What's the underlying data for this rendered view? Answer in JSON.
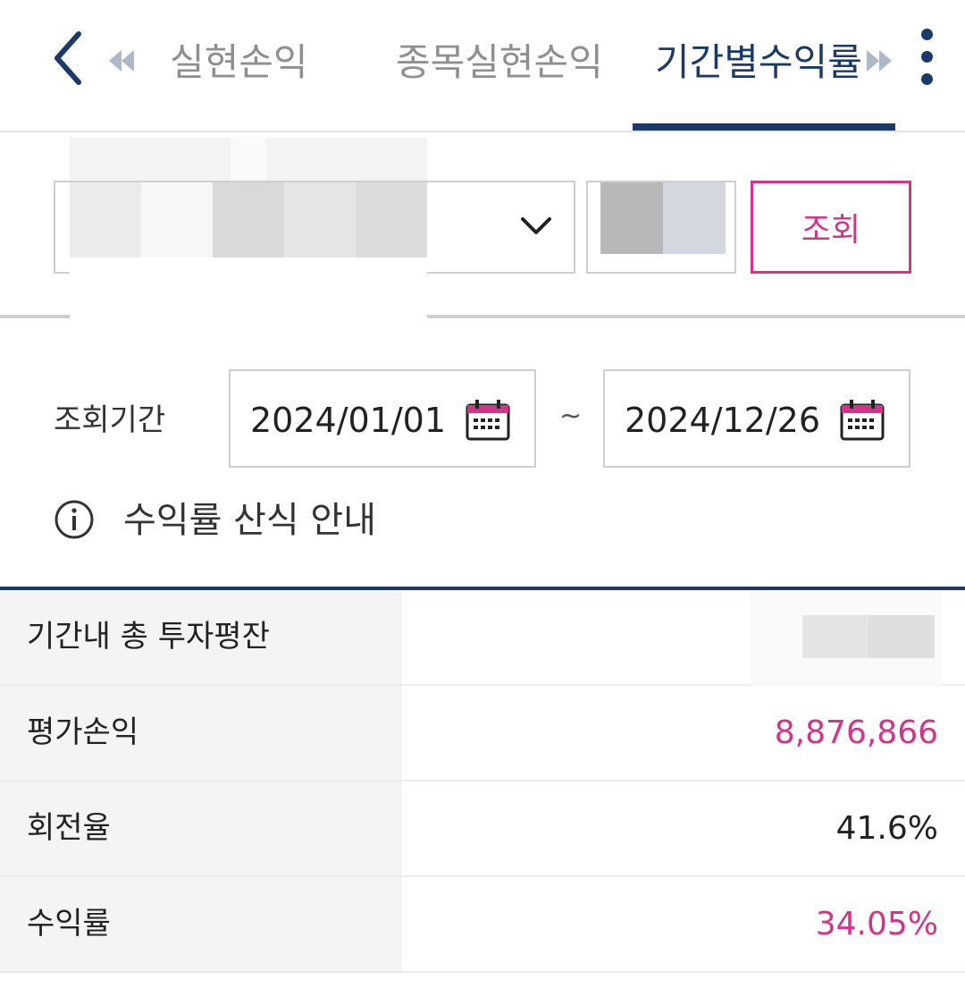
{
  "header": {
    "tabs": [
      {
        "label": "실현손익",
        "active": false
      },
      {
        "label": "종목실현손익",
        "active": false
      },
      {
        "label": "기간별수익률",
        "active": true
      }
    ],
    "icons": {
      "back": "chevron-left-icon",
      "prev": "double-chevron-left-icon",
      "next": "double-chevron-right-icon",
      "more": "more-vertical-icon"
    }
  },
  "account": {
    "query_label": "조회"
  },
  "period": {
    "label": "조회기간",
    "from": "2024/01/01",
    "to": "2024/12/26",
    "separator": "~"
  },
  "info": {
    "text": "수익률 산식 안내"
  },
  "summary": {
    "rows": [
      {
        "label": "기간내 총 투자평잔",
        "value": ""
      },
      {
        "label": "평가손익",
        "value": "8,876,866"
      },
      {
        "label": "회전율",
        "value": "41.6%"
      },
      {
        "label": "수익률",
        "value": "34.05%"
      }
    ]
  },
  "colors": {
    "brand_navy": "#1b3a67",
    "accent_pink": "#d4338a"
  }
}
